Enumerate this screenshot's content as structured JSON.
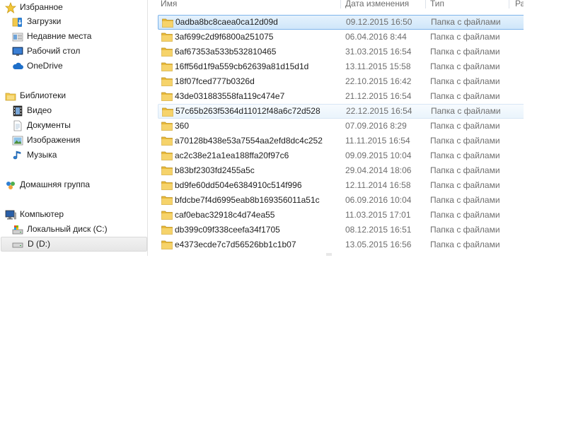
{
  "nav": {
    "items": [
      {
        "label": "Избранное",
        "icon": "star-icon"
      },
      {
        "label": "Загрузки",
        "icon": "downloads-folder-icon"
      },
      {
        "label": "Недавние места",
        "icon": "recent-places-icon"
      },
      {
        "label": "Рабочий стол",
        "icon": "desktop-icon"
      },
      {
        "label": "OneDrive",
        "icon": "cloud-icon"
      },
      {
        "label": "Библиотеки",
        "icon": "libraries-icon"
      },
      {
        "label": "Видео",
        "icon": "video-icon"
      },
      {
        "label": "Документы",
        "icon": "documents-icon"
      },
      {
        "label": "Изображения",
        "icon": "pictures-icon"
      },
      {
        "label": "Музыка",
        "icon": "music-icon"
      },
      {
        "label": "Домашняя группа",
        "icon": "homegroup-icon"
      },
      {
        "label": "Компьютер",
        "icon": "computer-icon"
      },
      {
        "label": "Локальный диск (C:)",
        "icon": "local-disk-icon"
      },
      {
        "label": "D (D:)",
        "icon": "disk-drive-icon"
      }
    ]
  },
  "list": {
    "columns": {
      "name": "Имя",
      "date": "Дата изменения",
      "type": "Тип",
      "size": "Ра"
    },
    "rows": [
      {
        "name": "0adba8bc8caea0ca12d09d",
        "date": "09.12.2015 16:50",
        "type": "Папка с файлами"
      },
      {
        "name": "3af699c2d9f6800a251075",
        "date": "06.04.2016 8:44",
        "type": "Папка с файлами"
      },
      {
        "name": "6af67353a533b532810465",
        "date": "31.03.2015 16:54",
        "type": "Папка с файлами"
      },
      {
        "name": "16ff56d1f9a559cb62639a81d15d1d",
        "date": "13.11.2015 15:58",
        "type": "Папка с файлами"
      },
      {
        "name": "18f07fced777b0326d",
        "date": "22.10.2015 16:42",
        "type": "Папка с файлами"
      },
      {
        "name": "43de031883558fa119c474e7",
        "date": "21.12.2015 16:54",
        "type": "Папка с файлами"
      },
      {
        "name": "57c65b263f5364d11012f48a6c72d528",
        "date": "22.12.2015 16:54",
        "type": "Папка с файлами"
      },
      {
        "name": "360",
        "date": "07.09.2016 8:29",
        "type": "Папка с файлами"
      },
      {
        "name": "a70128b438e53a7554aa2efd8dc4c252",
        "date": "11.11.2015 16:54",
        "type": "Папка с файлами"
      },
      {
        "name": "ac2c38e21a1ea188ffa20f97c6",
        "date": "09.09.2015 10:04",
        "type": "Папка с файлами"
      },
      {
        "name": "b83bf2303fd2455a5c",
        "date": "29.04.2014 18:06",
        "type": "Папка с файлами"
      },
      {
        "name": "bd9fe60dd504e6384910c514f996",
        "date": "12.11.2014 16:58",
        "type": "Папка с файлами"
      },
      {
        "name": "bfdcbe7f4d6995eab8b169356011a51c",
        "date": "06.09.2016 10:04",
        "type": "Папка с файлами"
      },
      {
        "name": "caf0ebac32918c4d74ea55",
        "date": "11.03.2015 17:01",
        "type": "Папка с файлами"
      },
      {
        "name": "db399c09f338ceefa34f1705",
        "date": "08.12.2015 16:51",
        "type": "Папка с файлами"
      },
      {
        "name": "e4373ecde7c7d56526bb1c1b07",
        "date": "13.05.2015 16:56",
        "type": "Папка с файлами"
      }
    ]
  },
  "colors": {
    "selection_border": "#7eb4ea",
    "selection_fill": "#cfe6fa",
    "folder_yellow": "#f2c94c",
    "secondary_text": "#6d6d6d"
  }
}
